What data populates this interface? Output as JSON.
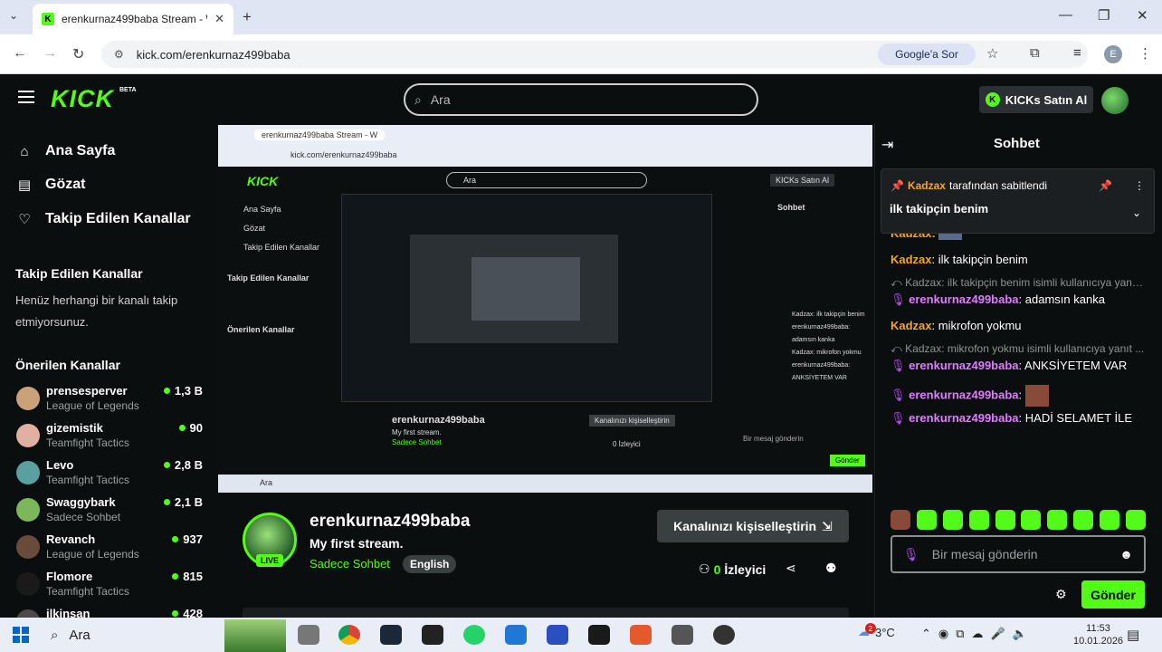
{
  "browser": {
    "tab_title": "erenkurnaz499baba Stream - W",
    "tab_close": "✕",
    "new_tab": "+",
    "url": "kick.com/erenkurnaz499baba",
    "google_ask": "Google'a Sor",
    "profile_letter": "E"
  },
  "header": {
    "logo": "KICK",
    "beta": "BETA",
    "search_placeholder": "Ara",
    "kicks_button": "KICKs Satın Al"
  },
  "sidebar": {
    "nav": [
      {
        "label": "Ana Sayfa",
        "icon": "home-icon"
      },
      {
        "label": "Gözat",
        "icon": "browse-icon"
      },
      {
        "label": "Takip Edilen Kanallar",
        "icon": "heart-icon"
      }
    ],
    "followed_heading": "Takip Edilen Kanallar",
    "followed_empty": "Henüz herhangi bir kanalı takip etmiyorsunuz.",
    "recommended_heading": "Önerilen Kanallar",
    "recommended": [
      {
        "name": "prensesperver",
        "game": "League of Legends",
        "viewers": "1,3 B",
        "color": "#c9a27a"
      },
      {
        "name": "gizemistik",
        "game": "Teamfight Tactics",
        "viewers": "90",
        "color": "#e0b0a0"
      },
      {
        "name": "Levo",
        "game": "Teamfight Tactics",
        "viewers": "2,8 B",
        "color": "#5aa0a0"
      },
      {
        "name": "Swaggybark",
        "game": "Sadece Sohbet",
        "viewers": "2,1 B",
        "color": "#7ab85a"
      },
      {
        "name": "Revanch",
        "game": "League of Legends",
        "viewers": "937",
        "color": "#6a4a3a"
      },
      {
        "name": "Flomore",
        "game": "Teamfight Tactics",
        "viewers": "815",
        "color": "#1a1a1a"
      },
      {
        "name": "ilkinsan",
        "game": "",
        "viewers": "428",
        "color": "#4a4a4a"
      }
    ]
  },
  "stream": {
    "channel": "erenkurnaz499baba",
    "title": "My first stream.",
    "category": "Sadece Sohbet",
    "language": "English",
    "live_badge": "LIVE",
    "customize_button": "Kanalınızı kişiselleştirin",
    "viewers": "0",
    "viewers_label": "İzleyici"
  },
  "chat": {
    "title": "Sohbet",
    "pinned_by_user": "Kadzax",
    "pinned_by_text": "tarafından sabitlendi",
    "pinned_message": "ilk takipçin benim",
    "partial_user": "Kadzax:",
    "messages": [
      {
        "type": "msg",
        "user": "Kadzax",
        "text": "ilk takipçin benim",
        "style": "u1"
      },
      {
        "type": "reply",
        "text": "Kadzax: ilk takipçin benim isimli kullanıcıya yanıt..."
      },
      {
        "type": "msg",
        "user": "erenkurnaz499baba",
        "text": "adamsın kanka",
        "style": "u2"
      },
      {
        "type": "msg",
        "user": "Kadzax",
        "text": "mikrofon yokmu",
        "style": "u1"
      },
      {
        "type": "reply",
        "text": "Kadzax: mikrofon yokmu isimli kullanıcıya yanıt ..."
      },
      {
        "type": "msg",
        "user": "erenkurnaz499baba",
        "text": "ANKSİYETEM VAR",
        "style": "u2"
      },
      {
        "type": "msg",
        "user": "erenkurnaz499baba",
        "text": "",
        "style": "u2"
      },
      {
        "type": "msg",
        "user": "erenkurnaz499baba",
        "text": "HADİ SELAMET İLE",
        "style": "u2"
      }
    ],
    "input_placeholder": "Bir mesaj gönderin",
    "send_button": "Gönder"
  },
  "video_inner": {
    "url": "kick.com/erenkurnaz499baba",
    "channel": "erenkurnaz499baba",
    "title": "My first stream.",
    "category": "Sadece Sohbet",
    "lang": "English",
    "customize": "Kanalınızı kişiselleştirin",
    "viewers": "0 İzleyici",
    "chat_title": "Sohbet",
    "pinned": "Kadzax tarafından sabitlendi",
    "pinned_msg": "ilk takipçin benim",
    "msgs": [
      "Kadzax: ilk takipçin benim",
      "erenkurnaz499baba: adamsın kanka",
      "Kadzax: mikrofon yokmu",
      "erenkurnaz499baba: ANKSİYETEM VAR",
      "erenkurnaz499baba:",
      "erenkurnaz499baba: HADİ SELAMET İLE"
    ],
    "input": "Bir mesaj gönderin",
    "send": "Gönder",
    "search": "Ara",
    "kicks": "KICKs Satın Al"
  },
  "taskbar": {
    "search": "Ara",
    "temp": "3°C",
    "time": "11:53",
    "date": "10.01.2026",
    "weather_badge": "2"
  },
  "colors": {
    "accent": "#53fc18",
    "bg": "#0b0e0f",
    "orange_user": "#f5a623",
    "purple_user": "#e07bff"
  }
}
